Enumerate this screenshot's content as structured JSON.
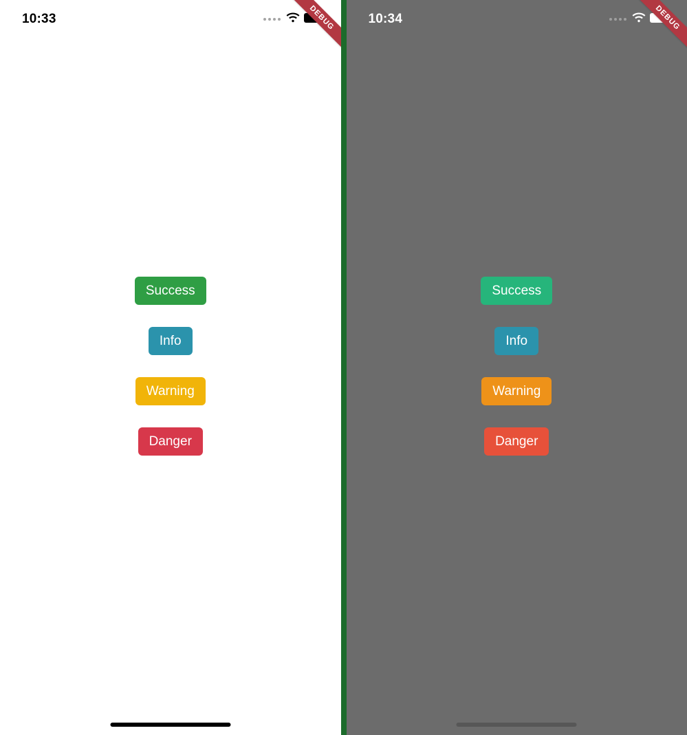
{
  "debug_label": "DEBUG",
  "panels": {
    "light": {
      "time": "10:33",
      "bg": "#ffffff",
      "status_fg": "#000000",
      "buttons": {
        "success": {
          "label": "Success",
          "color": "#2f9e44"
        },
        "info": {
          "label": "Info",
          "color": "#2b93ac"
        },
        "warning": {
          "label": "Warning",
          "color": "#f1b409"
        },
        "danger": {
          "label": "Danger",
          "color": "#d7384b"
        }
      }
    },
    "dark": {
      "time": "10:34",
      "bg": "#6c6c6c",
      "status_fg": "#ffffff",
      "buttons": {
        "success": {
          "label": "Success",
          "color": "#26b57b"
        },
        "info": {
          "label": "Info",
          "color": "#2b93ac"
        },
        "warning": {
          "label": "Warning",
          "color": "#ee9219"
        },
        "danger": {
          "label": "Danger",
          "color": "#e7513a"
        }
      }
    }
  }
}
